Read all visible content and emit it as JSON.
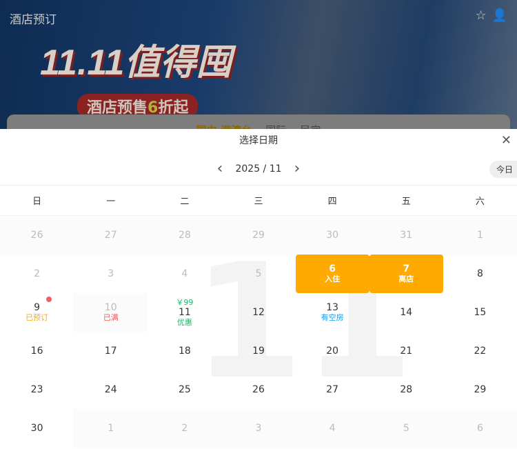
{
  "header": {
    "title": "酒店预订",
    "icons": [
      "star-icon",
      "user-icon"
    ]
  },
  "banner": {
    "headline": "11.11值得囤",
    "sub_prefix": "酒店预售",
    "sub_num": "6",
    "sub_suffix": "折起"
  },
  "tabs": [
    "国内·港澳台",
    "国际",
    "民宿"
  ],
  "sheet": {
    "title": "选择日期",
    "month": "2025 / 11",
    "today": "今日"
  },
  "weekdays": [
    "日",
    "一",
    "二",
    "三",
    "四",
    "五",
    "六"
  ],
  "watermark": "11",
  "days": [
    {
      "d": "26",
      "s": "dis"
    },
    {
      "d": "27",
      "s": "dis"
    },
    {
      "d": "28",
      "s": "dis"
    },
    {
      "d": "29",
      "s": "dis"
    },
    {
      "d": "30",
      "s": "dis"
    },
    {
      "d": "31",
      "s": "dis"
    },
    {
      "d": "1",
      "s": "dis"
    },
    {
      "d": "2",
      "s": "past"
    },
    {
      "d": "3",
      "s": "past"
    },
    {
      "d": "4",
      "s": "past"
    },
    {
      "d": "5",
      "s": "past"
    },
    {
      "d": "6",
      "s": "sel",
      "sub": "入住"
    },
    {
      "d": "7",
      "s": "sel",
      "sub": "离店"
    },
    {
      "d": "8"
    },
    {
      "d": "9",
      "sub": "已预订",
      "subColor": "#ffaa00",
      "dot": true
    },
    {
      "d": "10",
      "s": "dis",
      "sub": "已满",
      "subColor": "#f06060"
    },
    {
      "d": "11",
      "top": "￥99",
      "sub": "优惠",
      "subColor": "#1cb46a"
    },
    {
      "d": "12"
    },
    {
      "d": "13",
      "sub": "有空房",
      "subColor": "#1a9be8"
    },
    {
      "d": "14"
    },
    {
      "d": "15"
    },
    {
      "d": "16"
    },
    {
      "d": "17"
    },
    {
      "d": "18"
    },
    {
      "d": "19"
    },
    {
      "d": "20"
    },
    {
      "d": "21"
    },
    {
      "d": "22"
    },
    {
      "d": "23"
    },
    {
      "d": "24"
    },
    {
      "d": "25"
    },
    {
      "d": "26"
    },
    {
      "d": "27"
    },
    {
      "d": "28"
    },
    {
      "d": "29"
    },
    {
      "d": "30"
    },
    {
      "d": "1",
      "s": "dis"
    },
    {
      "d": "2",
      "s": "dis"
    },
    {
      "d": "3",
      "s": "dis"
    },
    {
      "d": "4",
      "s": "dis"
    },
    {
      "d": "5",
      "s": "dis"
    },
    {
      "d": "6",
      "s": "dis"
    }
  ]
}
